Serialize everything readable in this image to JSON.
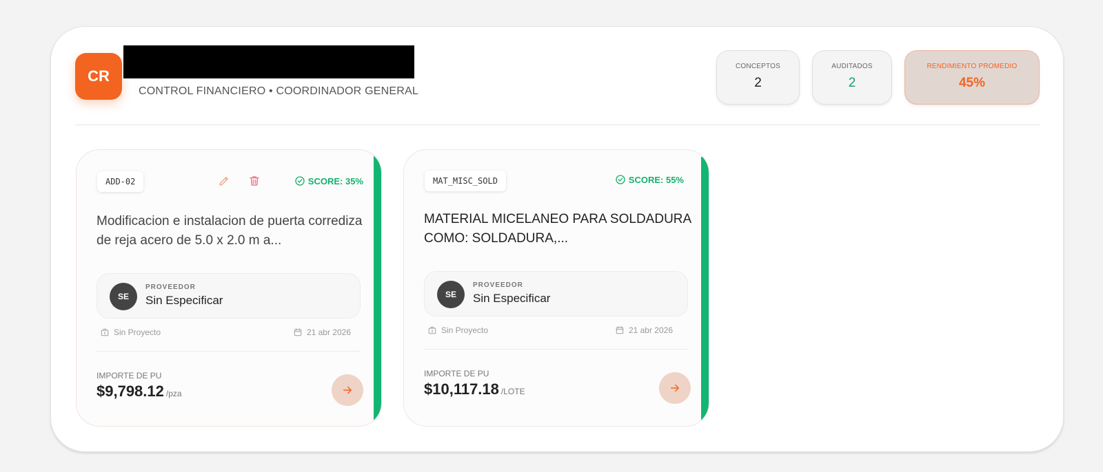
{
  "header": {
    "avatar_initials": "CR",
    "subtitle": "CONTROL FINANCIERO • COORDINADOR GENERAL"
  },
  "stats": [
    {
      "label": "CONCEPTOS",
      "value": "2"
    },
    {
      "label": "AUDITADOS",
      "value": "2"
    },
    {
      "label": "RENDIMIENTO PROMEDIO",
      "value": "45%"
    }
  ],
  "cards": [
    {
      "code": "ADD-02",
      "score": "SCORE: 35%",
      "description": "Modificacion e instalacion de puerta corrediza de reja acero de 5.0 x 2.0 m a...",
      "provider_initials": "SE",
      "provider_label": "PROVEEDOR",
      "provider": "Sin Especificar",
      "project": "Sin Proyecto",
      "date": "21 abr 2026",
      "amount_label": "IMPORTE DE PU",
      "amount": "$9,798.12",
      "unit": "/pza"
    },
    {
      "code": "MAT_MISC_SOLD",
      "score": "SCORE: 55%",
      "description": "MATERIAL MICELANEO PARA SOLDADURA COMO: SOLDADURA,...",
      "provider_initials": "SE",
      "provider_label": "PROVEEDOR",
      "provider": "Sin Especificar",
      "project": "Sin Proyecto",
      "date": "21 abr 2026",
      "amount_label": "IMPORTE DE PU",
      "amount": "$10,117.18",
      "unit": "/LOTE"
    }
  ],
  "colors": {
    "accent": "#f26420",
    "score_green": "#15b06e",
    "card_stripe": "#12b572"
  },
  "icons": [
    "pencil-icon",
    "trash-icon",
    "check-circle-icon",
    "building-icon",
    "calendar-icon",
    "arrow-right-icon"
  ]
}
